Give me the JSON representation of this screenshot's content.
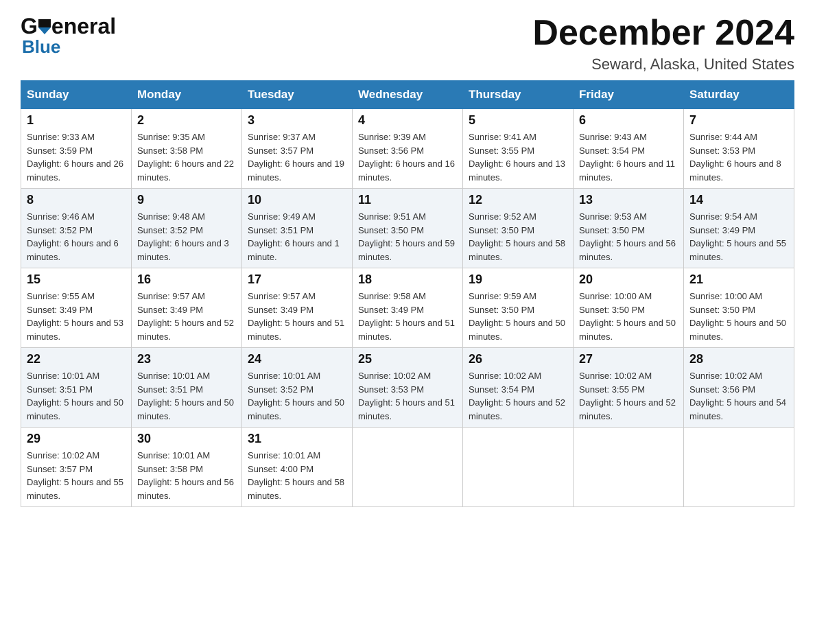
{
  "header": {
    "title": "December 2024",
    "subtitle": "Seward, Alaska, United States",
    "logo_line1": "General",
    "logo_line2": "Blue"
  },
  "columns": [
    "Sunday",
    "Monday",
    "Tuesday",
    "Wednesday",
    "Thursday",
    "Friday",
    "Saturday"
  ],
  "weeks": [
    [
      {
        "day": "1",
        "sunrise": "9:33 AM",
        "sunset": "3:59 PM",
        "daylight": "6 hours and 26 minutes."
      },
      {
        "day": "2",
        "sunrise": "9:35 AM",
        "sunset": "3:58 PM",
        "daylight": "6 hours and 22 minutes."
      },
      {
        "day": "3",
        "sunrise": "9:37 AM",
        "sunset": "3:57 PM",
        "daylight": "6 hours and 19 minutes."
      },
      {
        "day": "4",
        "sunrise": "9:39 AM",
        "sunset": "3:56 PM",
        "daylight": "6 hours and 16 minutes."
      },
      {
        "day": "5",
        "sunrise": "9:41 AM",
        "sunset": "3:55 PM",
        "daylight": "6 hours and 13 minutes."
      },
      {
        "day": "6",
        "sunrise": "9:43 AM",
        "sunset": "3:54 PM",
        "daylight": "6 hours and 11 minutes."
      },
      {
        "day": "7",
        "sunrise": "9:44 AM",
        "sunset": "3:53 PM",
        "daylight": "6 hours and 8 minutes."
      }
    ],
    [
      {
        "day": "8",
        "sunrise": "9:46 AM",
        "sunset": "3:52 PM",
        "daylight": "6 hours and 6 minutes."
      },
      {
        "day": "9",
        "sunrise": "9:48 AM",
        "sunset": "3:52 PM",
        "daylight": "6 hours and 3 minutes."
      },
      {
        "day": "10",
        "sunrise": "9:49 AM",
        "sunset": "3:51 PM",
        "daylight": "6 hours and 1 minute."
      },
      {
        "day": "11",
        "sunrise": "9:51 AM",
        "sunset": "3:50 PM",
        "daylight": "5 hours and 59 minutes."
      },
      {
        "day": "12",
        "sunrise": "9:52 AM",
        "sunset": "3:50 PM",
        "daylight": "5 hours and 58 minutes."
      },
      {
        "day": "13",
        "sunrise": "9:53 AM",
        "sunset": "3:50 PM",
        "daylight": "5 hours and 56 minutes."
      },
      {
        "day": "14",
        "sunrise": "9:54 AM",
        "sunset": "3:49 PM",
        "daylight": "5 hours and 55 minutes."
      }
    ],
    [
      {
        "day": "15",
        "sunrise": "9:55 AM",
        "sunset": "3:49 PM",
        "daylight": "5 hours and 53 minutes."
      },
      {
        "day": "16",
        "sunrise": "9:57 AM",
        "sunset": "3:49 PM",
        "daylight": "5 hours and 52 minutes."
      },
      {
        "day": "17",
        "sunrise": "9:57 AM",
        "sunset": "3:49 PM",
        "daylight": "5 hours and 51 minutes."
      },
      {
        "day": "18",
        "sunrise": "9:58 AM",
        "sunset": "3:49 PM",
        "daylight": "5 hours and 51 minutes."
      },
      {
        "day": "19",
        "sunrise": "9:59 AM",
        "sunset": "3:50 PM",
        "daylight": "5 hours and 50 minutes."
      },
      {
        "day": "20",
        "sunrise": "10:00 AM",
        "sunset": "3:50 PM",
        "daylight": "5 hours and 50 minutes."
      },
      {
        "day": "21",
        "sunrise": "10:00 AM",
        "sunset": "3:50 PM",
        "daylight": "5 hours and 50 minutes."
      }
    ],
    [
      {
        "day": "22",
        "sunrise": "10:01 AM",
        "sunset": "3:51 PM",
        "daylight": "5 hours and 50 minutes."
      },
      {
        "day": "23",
        "sunrise": "10:01 AM",
        "sunset": "3:51 PM",
        "daylight": "5 hours and 50 minutes."
      },
      {
        "day": "24",
        "sunrise": "10:01 AM",
        "sunset": "3:52 PM",
        "daylight": "5 hours and 50 minutes."
      },
      {
        "day": "25",
        "sunrise": "10:02 AM",
        "sunset": "3:53 PM",
        "daylight": "5 hours and 51 minutes."
      },
      {
        "day": "26",
        "sunrise": "10:02 AM",
        "sunset": "3:54 PM",
        "daylight": "5 hours and 52 minutes."
      },
      {
        "day": "27",
        "sunrise": "10:02 AM",
        "sunset": "3:55 PM",
        "daylight": "5 hours and 52 minutes."
      },
      {
        "day": "28",
        "sunrise": "10:02 AM",
        "sunset": "3:56 PM",
        "daylight": "5 hours and 54 minutes."
      }
    ],
    [
      {
        "day": "29",
        "sunrise": "10:02 AM",
        "sunset": "3:57 PM",
        "daylight": "5 hours and 55 minutes."
      },
      {
        "day": "30",
        "sunrise": "10:01 AM",
        "sunset": "3:58 PM",
        "daylight": "5 hours and 56 minutes."
      },
      {
        "day": "31",
        "sunrise": "10:01 AM",
        "sunset": "4:00 PM",
        "daylight": "5 hours and 58 minutes."
      },
      null,
      null,
      null,
      null
    ]
  ],
  "labels": {
    "sunrise": "Sunrise:",
    "sunset": "Sunset:",
    "daylight": "Daylight:"
  }
}
